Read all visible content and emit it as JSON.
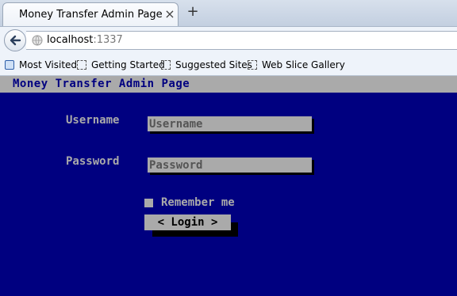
{
  "browser": {
    "tab_title": "Money Transfer Admin Page",
    "tab_close": "×",
    "new_tab": "+",
    "url_host": "localhost",
    "url_port": ":1337",
    "bookmarks": [
      {
        "label": "Most Visited",
        "icon": "most-visited-icon"
      },
      {
        "label": "Getting Started",
        "icon": "page-icon"
      },
      {
        "label": "Suggested Sites",
        "icon": "page-icon"
      },
      {
        "label": "Web Slice Gallery",
        "icon": "page-icon"
      }
    ]
  },
  "page": {
    "title": "Money Transfer Admin Page",
    "username_label": "Username",
    "username_placeholder": "Username",
    "password_label": "Password",
    "password_placeholder": "Password",
    "remember_label": "Remember me",
    "remember_checked": false,
    "login_label": "< Login >"
  },
  "colors": {
    "page_background": "#000080",
    "header_bar": "#aaaaaa",
    "label_text": "#aaaaaa",
    "field_background": "#aaaaaa"
  }
}
